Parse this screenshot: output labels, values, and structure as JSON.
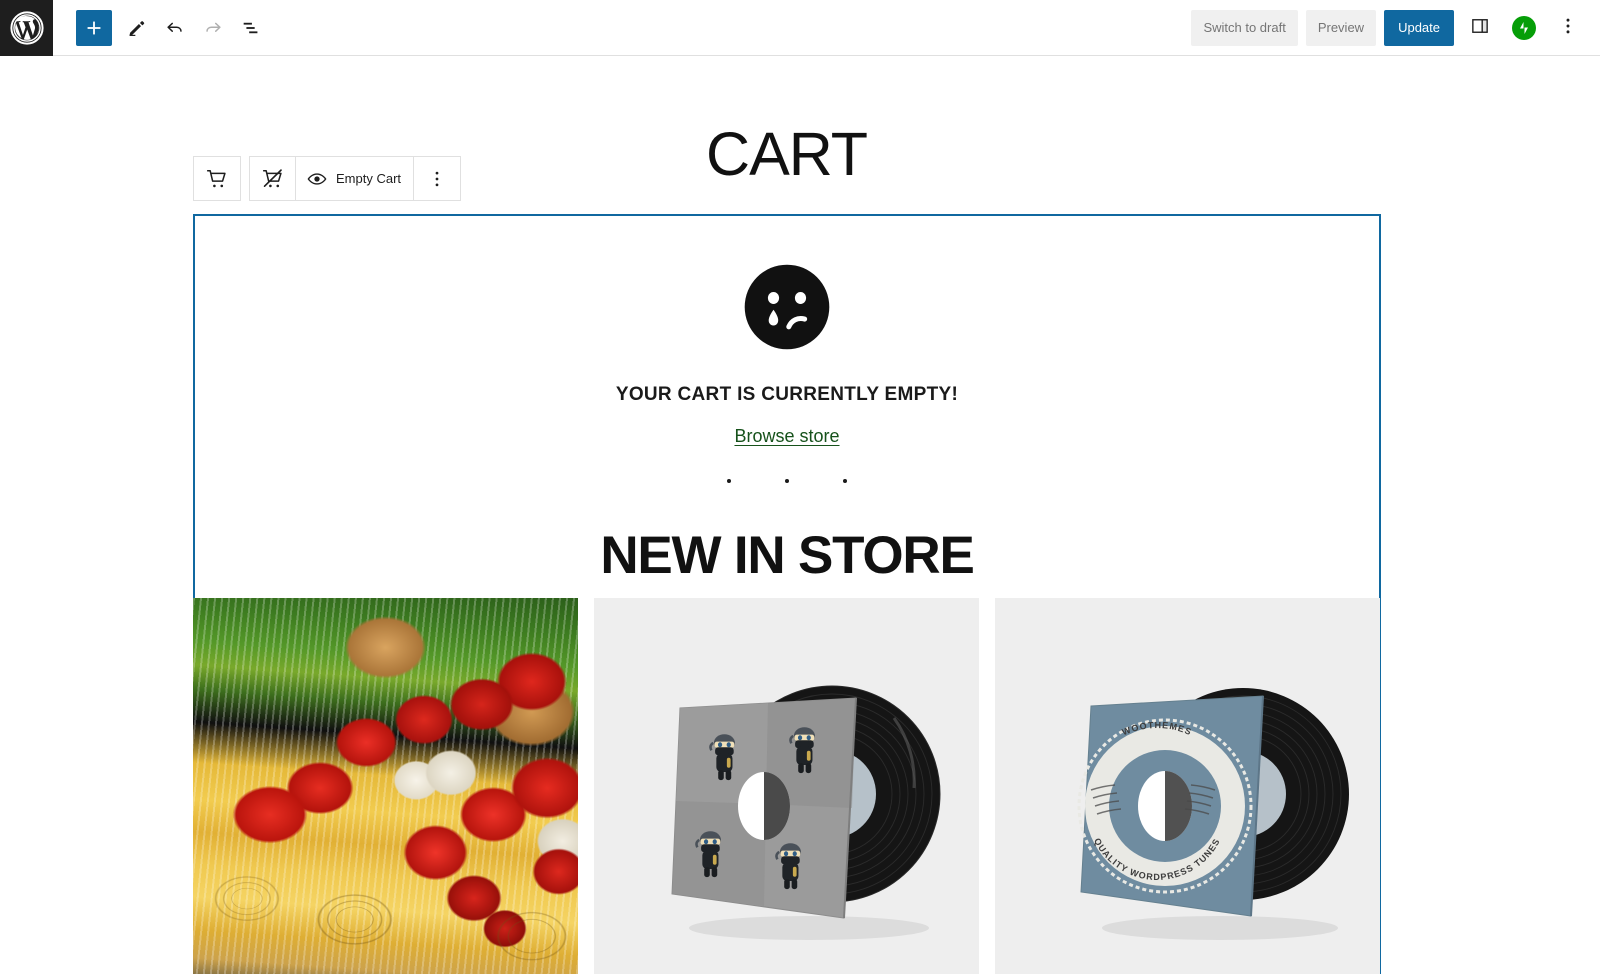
{
  "header": {
    "logo_icon": "wordpress-logo-icon",
    "left_tools": [
      {
        "name": "add-block-button",
        "icon": "plus-icon",
        "label": "Add block",
        "state": "active"
      },
      {
        "name": "tools-button",
        "icon": "pencil-icon",
        "label": "Tools",
        "state": "default"
      },
      {
        "name": "undo-button",
        "icon": "undo-arrow-icon",
        "label": "Undo",
        "state": "default"
      },
      {
        "name": "redo-button",
        "icon": "redo-arrow-icon",
        "label": "Redo",
        "state": "disabled"
      },
      {
        "name": "document-overview-button",
        "icon": "list-view-icon",
        "label": "Document Overview",
        "state": "default"
      }
    ],
    "switch_to_draft_label": "Switch to draft",
    "preview_label": "Preview",
    "update_label": "Update",
    "settings_icon": "sidebar-panel-icon",
    "jetpack_icon": "jetpack-logo-icon",
    "options_icon": "three-dots-vertical-icon"
  },
  "block_toolbar": {
    "drag_icon": "cart-icon",
    "items": [
      {
        "name": "cart-block-icon-button",
        "icon": "cart-off-icon",
        "label": ""
      },
      {
        "name": "empty-cart-toggle",
        "icon": "eye-icon",
        "label": "Empty Cart"
      },
      {
        "name": "block-options-button",
        "icon": "three-dots-vertical-icon",
        "label": ""
      }
    ]
  },
  "page": {
    "title": "CART"
  },
  "cart_block": {
    "sad_face_icon": "crying-face-icon",
    "empty_heading": "YOUR CART IS CURRENTLY EMPTY!",
    "browse_store_link": "Browse store",
    "divider_icon": "three-dot-divider",
    "new_in_store_heading": "NEW IN STORE"
  },
  "products": [
    {
      "name": "product-card-pasta",
      "alt": "Fresh pasta nests with cherry tomatoes, eggs and basil",
      "kind": "photo"
    },
    {
      "name": "product-card-ninja-vinyl",
      "alt": "Vinyl record with grey ninja character sleeve",
      "kind": "vinyl",
      "sleeve_color": "#9a9a9a",
      "caption_top": "",
      "caption_bottom": ""
    },
    {
      "name": "product-card-woothemes-vinyl",
      "alt": "Vinyl record with blue WooThemes sleeve",
      "kind": "vinyl",
      "sleeve_color": "#6f8ca0",
      "caption_top": "WOOTHEMES",
      "caption_bottom": "QUALITY WORDPRESS TUNES"
    }
  ],
  "colors": {
    "wp_blue": "#1068a0",
    "jetpack_green": "#069e08",
    "link_green": "#16521b",
    "toolbar_border": "#e0e0e0",
    "selection_blue": "#1068a0"
  }
}
